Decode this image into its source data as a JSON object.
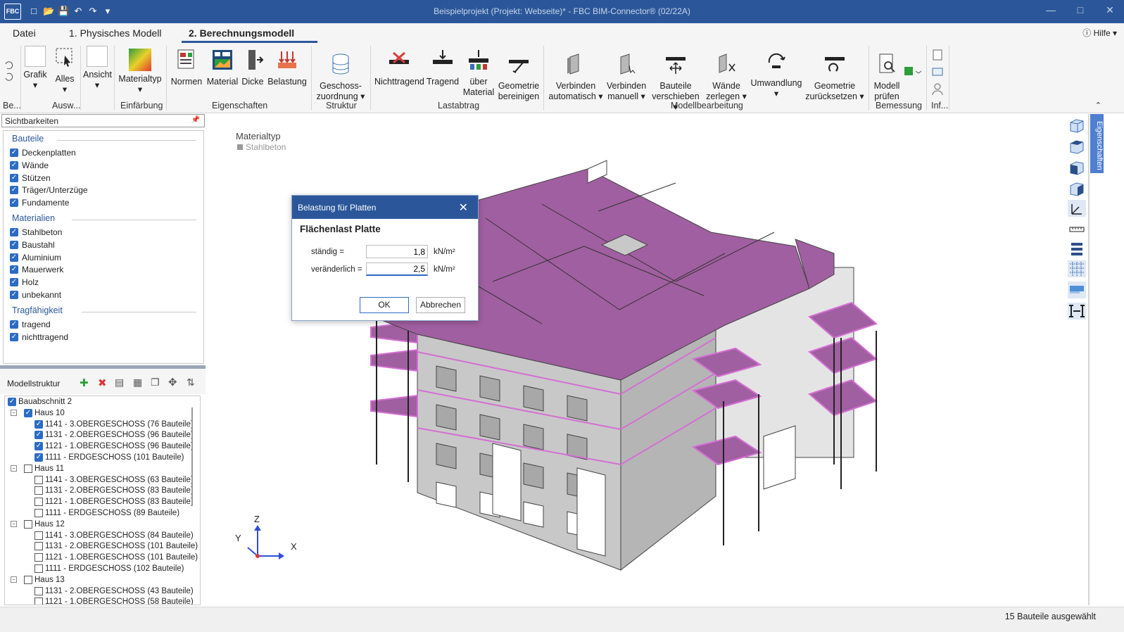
{
  "window": {
    "title": "Beispielprojekt (Projekt: Webseite)*  -  FBC BIM-Connector® (02/22A)",
    "logo": "FBC"
  },
  "menu": {
    "tabs": [
      "Datei",
      "1. Physisches Modell",
      "2. Berechnungsmodell"
    ],
    "active": 2,
    "help": "Hilfe"
  },
  "ribbon": {
    "buttons": {
      "grafik": "Grafik",
      "alles": "Alles",
      "ansicht": "Ansicht",
      "materialtyp": "Materialtyp",
      "normen": "Normen",
      "material": "Material",
      "dicke": "Dicke",
      "belastung": "Belastung",
      "geschoss": "Geschoss-\nzuordnung",
      "nichttragend": "Nichttragend",
      "tragend": "Tragend",
      "ueber_material": "über\nMaterial",
      "geometrie_bereinigen": "Geometrie\nbereinigen",
      "verbinden_auto": "Verbinden\nautomatisch",
      "verbinden_manuell": "Verbinden\nmanuell",
      "bauteile_verschieben": "Bauteile\nverschieben",
      "waende_zerlegen": "Wände\nzerlegen",
      "umwandlung": "Umwandlung",
      "geometrie_zuruecksetzen": "Geometrie\nzurücksetzen",
      "modell_pruefen": "Modell\nprüfen"
    },
    "groups": {
      "be": "Be...",
      "ausw": "Ausw...",
      "einfaerbung": "Einfärbung",
      "eigenschaften": "Eigenschaften",
      "struktur": "Struktur",
      "lastabtrag": "Lastabtrag",
      "modellbearbeitung": "Modellbearbeitung",
      "bemessung": "Bemessung",
      "inf": "Inf..."
    }
  },
  "visibility": {
    "title": "Sichtbarkeiten",
    "sections": [
      {
        "title": "Bauteile",
        "items": [
          "Deckenplatten",
          "Wände",
          "Stützen",
          "Träger/Unterzüge",
          "Fundamente"
        ]
      },
      {
        "title": "Materialien",
        "items": [
          "Stahlbeton",
          "Baustahl",
          "Aluminium",
          "Mauerwerk",
          "Holz",
          "unbekannt"
        ]
      },
      {
        "title": "Tragfähigkeit",
        "items": [
          "tragend",
          "nichttragend"
        ]
      }
    ]
  },
  "model_structure": {
    "title": "Modellstruktur",
    "tree": [
      {
        "label": "Bauabschnitt 2",
        "level": 0,
        "checked": true,
        "toggle": ""
      },
      {
        "label": "Haus 10",
        "level": 1,
        "checked": true,
        "toggle": "−"
      },
      {
        "label": "1141 - 3.OBERGESCHOSS (76 Bauteile)",
        "level": 2,
        "checked": true
      },
      {
        "label": "1131 - 2.OBERGESCHOSS (96 Bauteile)",
        "level": 2,
        "checked": true
      },
      {
        "label": "1121 - 1.OBERGESCHOSS (96 Bauteile)",
        "level": 2,
        "checked": true
      },
      {
        "label": "1111 - ERDGESCHOSS (101 Bauteile)",
        "level": 2,
        "checked": true
      },
      {
        "label": "Haus 11",
        "level": 1,
        "checked": false,
        "toggle": "−"
      },
      {
        "label": "1141 - 3.OBERGESCHOSS (63 Bauteile)",
        "level": 2,
        "checked": false
      },
      {
        "label": "1131 - 2.OBERGESCHOSS (83 Bauteile)",
        "level": 2,
        "checked": false
      },
      {
        "label": "1121 - 1.OBERGESCHOSS (83 Bauteile)",
        "level": 2,
        "checked": false
      },
      {
        "label": "1111 - ERDGESCHOSS (89 Bauteile)",
        "level": 2,
        "checked": false
      },
      {
        "label": "Haus 12",
        "level": 1,
        "checked": false,
        "toggle": "−"
      },
      {
        "label": "1141 - 3.OBERGESCHOSS (84 Bauteile)",
        "level": 2,
        "checked": false
      },
      {
        "label": "1131 - 2.OBERGESCHOSS (101 Bauteile)",
        "level": 2,
        "checked": false
      },
      {
        "label": "1121 - 1.OBERGESCHOSS (101 Bauteile)",
        "level": 2,
        "checked": false
      },
      {
        "label": "1111 - ERDGESCHOSS (102 Bauteile)",
        "level": 2,
        "checked": false
      },
      {
        "label": "Haus 13",
        "level": 1,
        "checked": false,
        "toggle": "−"
      },
      {
        "label": "1131 - 2.OBERGESCHOSS (43 Bauteile)",
        "level": 2,
        "checked": false
      },
      {
        "label": "1121 - 1.OBERGESCHOSS (58 Bauteile)",
        "level": 2,
        "checked": false
      }
    ]
  },
  "viewport": {
    "legend_title": "Materialtyp",
    "legend_item": "Stahlbeton",
    "axes": {
      "x": "X",
      "y": "Y",
      "z": "Z"
    },
    "slab_color": "#a05fa0",
    "wall_color": "#c8c8c8"
  },
  "dialog": {
    "title": "Belastung für Platten",
    "heading": "Flächenlast Platte",
    "staendig_label": "ständig =",
    "staendig_value": "1,8",
    "veraenderlich_label": "veränderlich =",
    "veraenderlich_value": "2,5",
    "unit": "kN/m²",
    "ok": "OK",
    "cancel": "Abbrechen"
  },
  "sidetab": "Eigenschaften",
  "status": "15 Bauteile ausgewählt"
}
